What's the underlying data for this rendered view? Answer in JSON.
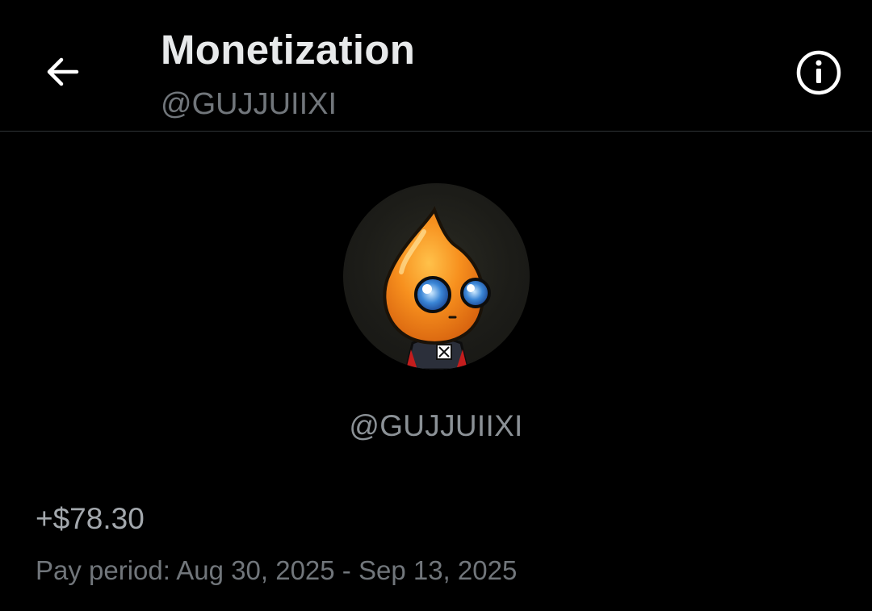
{
  "header": {
    "title": "Monetization",
    "handle": "@GUJJUIIXI",
    "back_icon": "arrow-left-icon",
    "info_icon": "info-circle-icon"
  },
  "profile": {
    "avatar_icon": "flame-character-avatar",
    "handle": "@GUJJUIIXI"
  },
  "earnings": {
    "amount": "+$78.30",
    "pay_period_label": "Pay period:",
    "pay_period_range": "Aug 30, 2025 - Sep 13, 2025"
  },
  "colors": {
    "background": "#000000",
    "primary_text": "#e7e9ea",
    "secondary_text": "#71767b",
    "divider": "#2f3336",
    "avatar_flame": "#f7901e"
  }
}
